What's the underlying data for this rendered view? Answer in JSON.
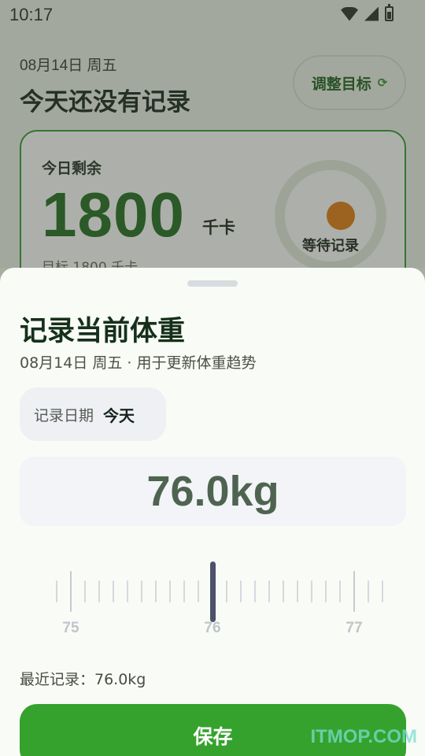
{
  "status_bar": {
    "time": "10:17",
    "icons": [
      "wifi-icon",
      "signal-icon",
      "battery-icon"
    ]
  },
  "background_page": {
    "date": "08月14日 周五",
    "title": "今天还没有记录",
    "adjust_button": {
      "label": "调整目标",
      "icon": "refresh-icon",
      "icon_glyph": "⟳"
    },
    "summary": {
      "remaining_label": "今日剩余",
      "remaining_value": "1800",
      "remaining_unit": "千卡",
      "target_text": "目标 1800 千卡",
      "ring_label": "等待记录",
      "progress_fraction": 0
    }
  },
  "sheet": {
    "title": "记录当前体重",
    "subtitle": "08月14日 周五 · 用于更新体重趋势",
    "date_chip": {
      "label": "记录日期",
      "value": "今天"
    },
    "weight_display": "76.0kg",
    "ruler": {
      "min": 74.9,
      "max": 77.2,
      "step": 0.1,
      "selected": 76.0,
      "labels": [
        "75",
        "76",
        "77"
      ]
    },
    "recent_text": "最近记录：76.0kg",
    "save_label": "保存"
  },
  "watermark": "ITMOP.COM",
  "colors": {
    "accent_green": "#35a22d",
    "dark_green": "#1f6a1f",
    "orange": "#e07b10",
    "cursor": "#4c526a"
  }
}
